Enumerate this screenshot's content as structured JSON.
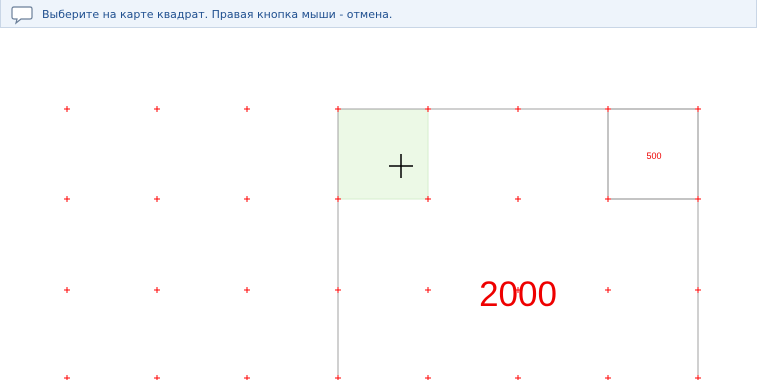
{
  "hint": {
    "icon": "speech-bubble-icon",
    "text": "Выберите на карте квадрат. Правая кнопка мыши - отмена."
  },
  "map": {
    "big_square_label": "2000",
    "small_square_label": "500",
    "grid_color": "#ff0000",
    "frame_color": "#999999",
    "highlight_color": "#ecf9e6"
  }
}
